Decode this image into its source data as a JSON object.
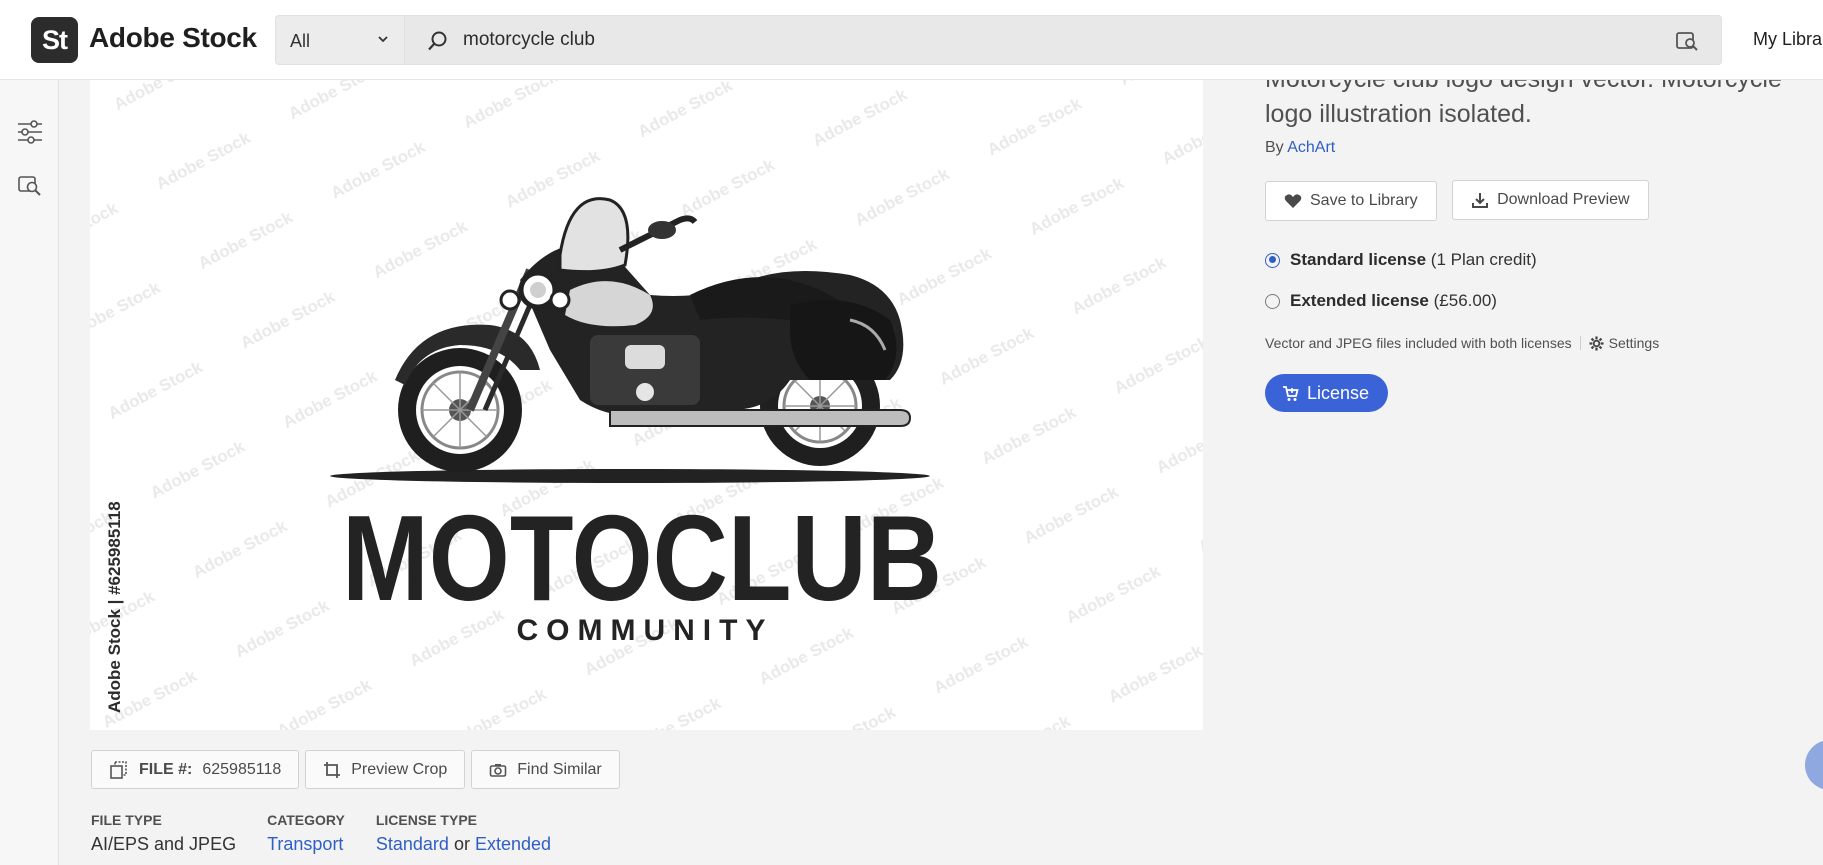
{
  "header": {
    "logo_badge": "St",
    "logo_text": "Adobe Stock",
    "scope_label": "All",
    "search_value": "motorcycle club",
    "my_library": "My Librar"
  },
  "preview": {
    "watermark_side": "Adobe Stock | #625985118",
    "logo_main": "MOTOCLUB",
    "logo_sub": "COMMUNITY",
    "tile_watermark": "Adobe Stock"
  },
  "details": {
    "title": "Motorcycle club logo design vector. Motorcycle logo illustration isolated.",
    "by_label": "By",
    "author": "AchArt",
    "save_button": "Save to Library",
    "download_button": "Download Preview",
    "licenses": [
      {
        "name": "Standard license",
        "price": "(1 Plan credit)",
        "checked": true
      },
      {
        "name": "Extended license",
        "price": "(£56.00)",
        "checked": false
      }
    ],
    "note": "Vector and JPEG files included with both licenses",
    "settings": "Settings",
    "license_button": "License"
  },
  "actions": {
    "file_label": "FILE #:",
    "file_number": "625985118",
    "preview_crop": "Preview Crop",
    "find_similar": "Find Similar"
  },
  "meta": {
    "file_type_label": "FILE TYPE",
    "file_type": "AI/EPS and JPEG",
    "category_label": "CATEGORY",
    "category": "Transport",
    "license_type_label": "LICENSE TYPE",
    "license_standard": "Standard",
    "license_or": "or",
    "license_extended": "Extended"
  },
  "colors": {
    "accent": "#3b63d8",
    "link": "#2f5fc4",
    "dark": "#2c2c2c"
  },
  "icons": [
    "chevron-down-icon",
    "search-icon",
    "visual-search-icon",
    "filters-icon",
    "find-similar-icon",
    "heart-icon",
    "download-icon",
    "settings-icon",
    "cart-icon",
    "file-icon",
    "crop-icon",
    "camera-icon"
  ]
}
